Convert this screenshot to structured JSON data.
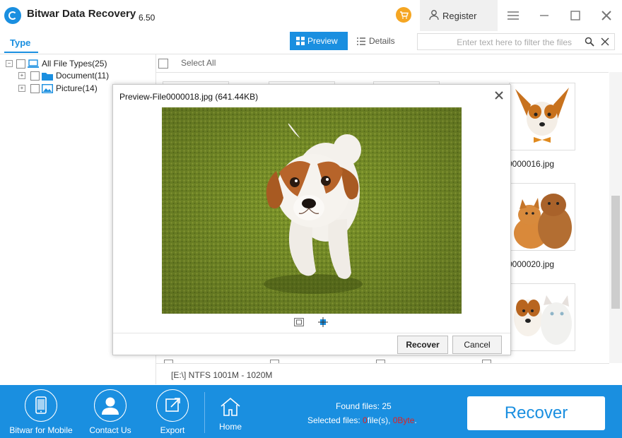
{
  "app": {
    "title": "Bitwar Data Recovery",
    "version": "6.50"
  },
  "header": {
    "register_label": "Register"
  },
  "toolbar": {
    "type_tab": "Type",
    "preview_label": "Preview",
    "details_label": "Details",
    "filter_placeholder": "Enter text here to filter the files"
  },
  "tree": {
    "root": {
      "label": "All File Types(25)",
      "expander": "−"
    },
    "items": [
      {
        "label": "Document(11)",
        "expander": "+"
      },
      {
        "label": "Picture(14)",
        "expander": "+"
      }
    ]
  },
  "grid": {
    "select_all": "Select All",
    "visible_names": [
      "0000016.jpg",
      "0000020.jpg"
    ]
  },
  "status": {
    "partition": "[E:\\] NTFS 1001M - 1020M"
  },
  "bottom": {
    "mobile_label": "Bitwar for Mobile",
    "contact_label": "Contact Us",
    "export_label": "Export",
    "home_label": "Home",
    "found_prefix": "Found files: ",
    "found_count": "25",
    "selected_prefix": "Selected files: ",
    "selected_count": "0",
    "selected_mid": "file(s), ",
    "selected_size": "0Byte",
    "selected_suffix": ".",
    "recover_label": "Recover"
  },
  "dialog": {
    "title": "Preview-File0000018.jpg (641.44KB)",
    "recover_label": "Recover",
    "cancel_label": "Cancel"
  },
  "colors": {
    "accent": "#1a8fe0",
    "cart": "#f5a623",
    "highlight": "#e02020",
    "grass": "#7f9a2a"
  }
}
